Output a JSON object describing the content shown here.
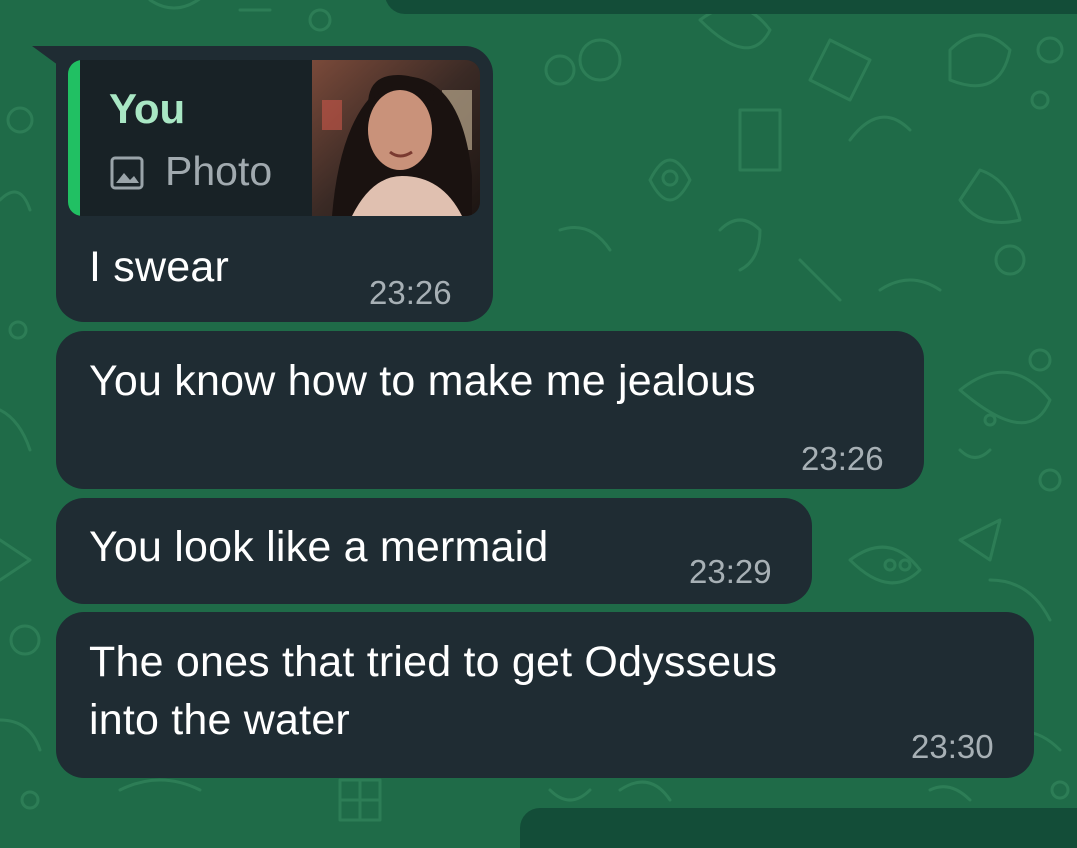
{
  "messages": [
    {
      "reply_to": {
        "author": "You",
        "type_label": "Photo",
        "type_icon": "image-icon"
      },
      "text": "I swear",
      "time": "23:26"
    },
    {
      "text": "You know how to make me jealous",
      "time": "23:26"
    },
    {
      "text": "You look like a mermaid",
      "time": "23:29"
    },
    {
      "text_lines": [
        "The ones that tried to get Odysseus",
        "into the water"
      ],
      "time": "23:30"
    }
  ],
  "colors": {
    "wallpaper": "#1f6b48",
    "bubble": "#1f2c33",
    "quote_bar": "#21c063",
    "quote_author": "#a9e7c4",
    "timestamp": "#a7b0b5"
  }
}
